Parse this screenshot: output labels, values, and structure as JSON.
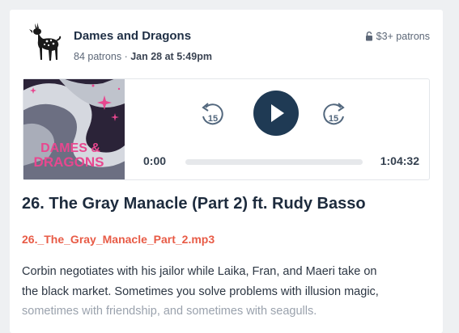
{
  "post": {
    "creator_name": "Dames and Dragons",
    "patron_count": "84 patrons",
    "separator": "·",
    "posted_at": "Jan 28 at 5:49pm",
    "tier_label": "$3+ patrons",
    "title": "26. The Gray Manacle (Part 2) ft. Rudy Basso",
    "attachment_filename": "26._The_Gray_Manacle_Part_2.mp3",
    "description_lines": [
      "Corbin negotiates with his jailor while Laika, Fran, and Maeri take on",
      "the black market. Sometimes you solve problems with illusion magic,",
      "sometimes with friendship, and sometimes with seagulls."
    ]
  },
  "player": {
    "current_time": "0:00",
    "total_time": "1:04:32",
    "skip_back_seconds": "15",
    "skip_forward_seconds": "15",
    "progress": 0,
    "artwork_text_line1": "DAMES &",
    "artwork_text_line2": "DRAGONS"
  },
  "colors": {
    "accent": "#e85b46",
    "play_button": "#1f3a54",
    "artwork_pink": "#e8478f",
    "artwork_dark": "#2b2338"
  },
  "icons": {
    "avatar": "deer-icon",
    "tier": "lock-icon",
    "play": "play-icon",
    "skip_back": "rewind-15-icon",
    "skip_forward": "forward-15-icon"
  }
}
